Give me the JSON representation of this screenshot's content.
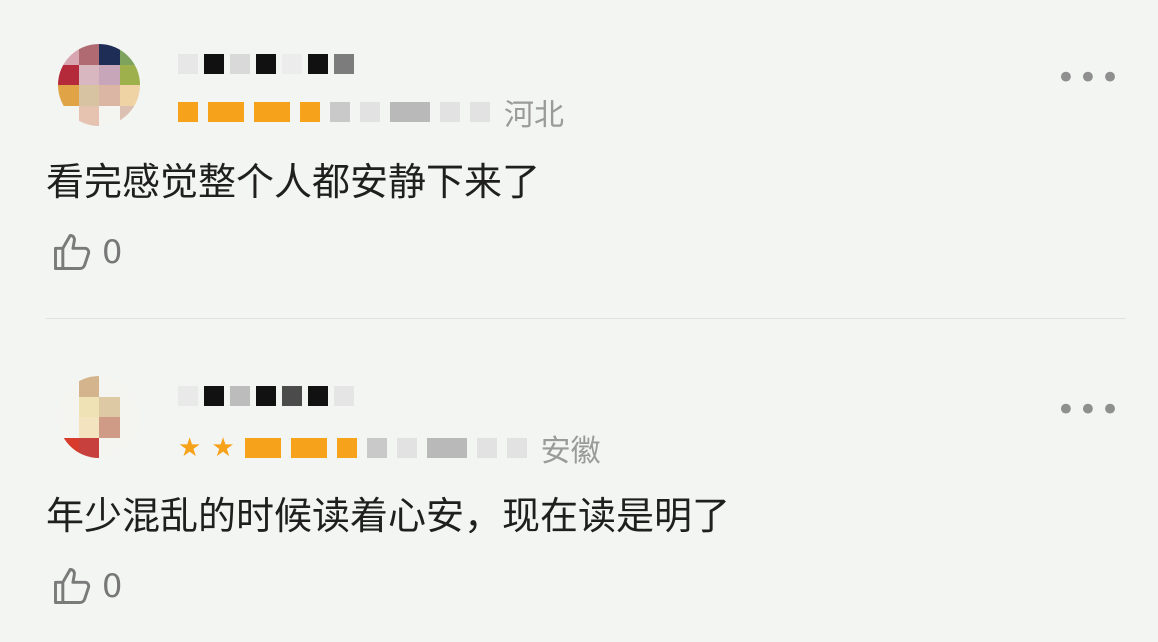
{
  "comments": [
    {
      "location": "河北",
      "text": "看完感觉整个人都安静下来了",
      "likes": "0",
      "avatar_colors": [
        "#d8a6b0",
        "#b06a72",
        "#1e2d55",
        "#7da35c",
        "#b52a3a",
        "#d9b7c1",
        "#c6a6b8",
        "#9eb04b",
        "#e0a346",
        "#d7c3a2",
        "#dbb6a4",
        "#f0d3a5",
        "#f4f5f1",
        "#e6c2b1",
        "#f4f5f1",
        "#dcc0b2"
      ],
      "name_mosaic": [
        "#e7e7e7",
        "#111111",
        "#d9d9d9",
        "#111111",
        "#ececec",
        "#111111",
        "#7c7c7c"
      ],
      "icons": {
        "more": "more-horizontal-icon",
        "like": "thumbs-up-icon"
      },
      "more_label": "•••"
    },
    {
      "location": "安徽",
      "text": "年少混乱的时候读着心安，现在读是明了",
      "likes": "0",
      "avatar_colors": [
        "#f4f5f1",
        "#d3b48c",
        "#f4f5f1",
        "#f4f5f1",
        "#f4f5f1",
        "#efe3b6",
        "#dec9a5",
        "#f4f5f1",
        "#f4f5f1",
        "#f3e4bf",
        "#cf9a86",
        "#f4f5f1",
        "#d73b2c",
        "#c8403d",
        "#f4f5f1",
        "#f4f5f1"
      ],
      "name_mosaic": [
        "#e9e9e9",
        "#111111",
        "#bcbcbc",
        "#111111",
        "#4b4b4b",
        "#111111",
        "#e5e5e5"
      ],
      "icons": {
        "more": "more-horizontal-icon",
        "like": "thumbs-up-icon"
      },
      "more_label": "•••"
    }
  ],
  "colors": {
    "background": "#f2f5f1",
    "text": "#1f1f1f",
    "muted": "#9a9a9a",
    "accent": "#f7a21b",
    "divider": "#dfe3de"
  }
}
